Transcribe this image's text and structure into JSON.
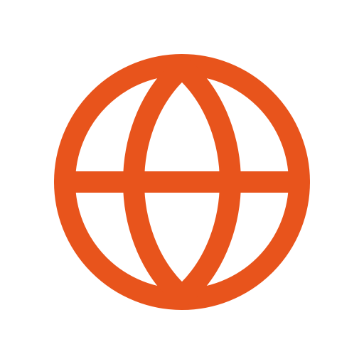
{
  "icon": {
    "name": "globe-icon",
    "color": "#E8541C",
    "background": "#FFFFFF"
  }
}
